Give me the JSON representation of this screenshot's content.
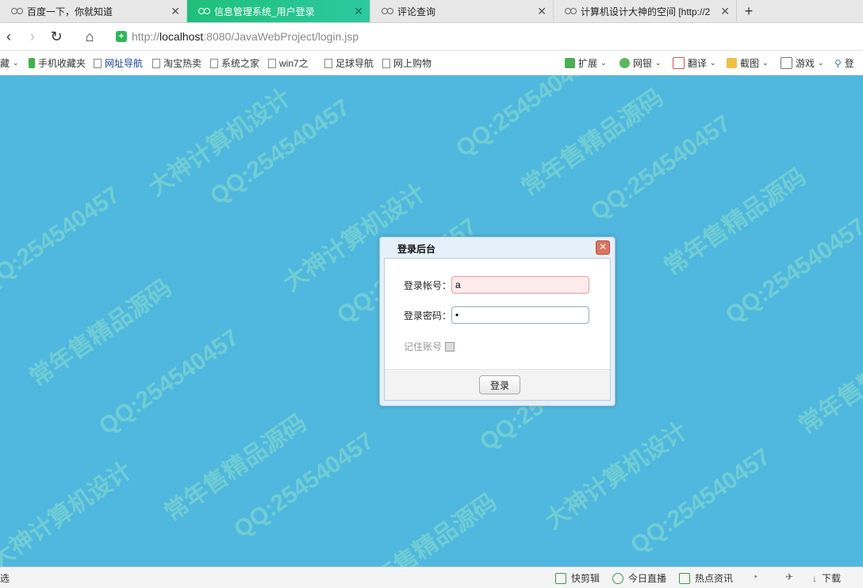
{
  "tabs": [
    {
      "title": "百度一下，你就知道",
      "active": false
    },
    {
      "title": "信息管理系统_用户登录",
      "active": true
    },
    {
      "title": "评论查询",
      "active": false
    },
    {
      "title": "计算机设计大神的空间 [http://2",
      "active": false
    }
  ],
  "newtab_label": "+",
  "address": {
    "scheme": "http://",
    "host": "localhost",
    "rest": ":8080/JavaWebProject/login.jsp"
  },
  "bookmarks": {
    "left_cut": "藏",
    "items": [
      "手机收藏夹",
      "网址导航",
      "淘宝热卖",
      "系统之家",
      "win7之",
      "足球导航",
      "网上购物"
    ],
    "right": [
      "扩展",
      "网银",
      "翻译",
      "截图",
      "游戏",
      "登"
    ]
  },
  "watermark": {
    "qq": "QQ:254540457",
    "line1": "常年售精品源码",
    "line2": "大神计算机设计"
  },
  "dialog": {
    "title": "登录后台",
    "account_label": "登录帐号：",
    "account_value": "a",
    "password_label": "登录密码：",
    "password_value": "•",
    "remember_label": "记住账号",
    "login_button": "登录"
  },
  "status": {
    "left_cut": "选",
    "items": [
      "快剪辑",
      "今日直播",
      "热点资讯",
      "下载"
    ]
  },
  "colors": {
    "accent_tab": "#1fbf7a",
    "page_bg": "#50b8de"
  }
}
